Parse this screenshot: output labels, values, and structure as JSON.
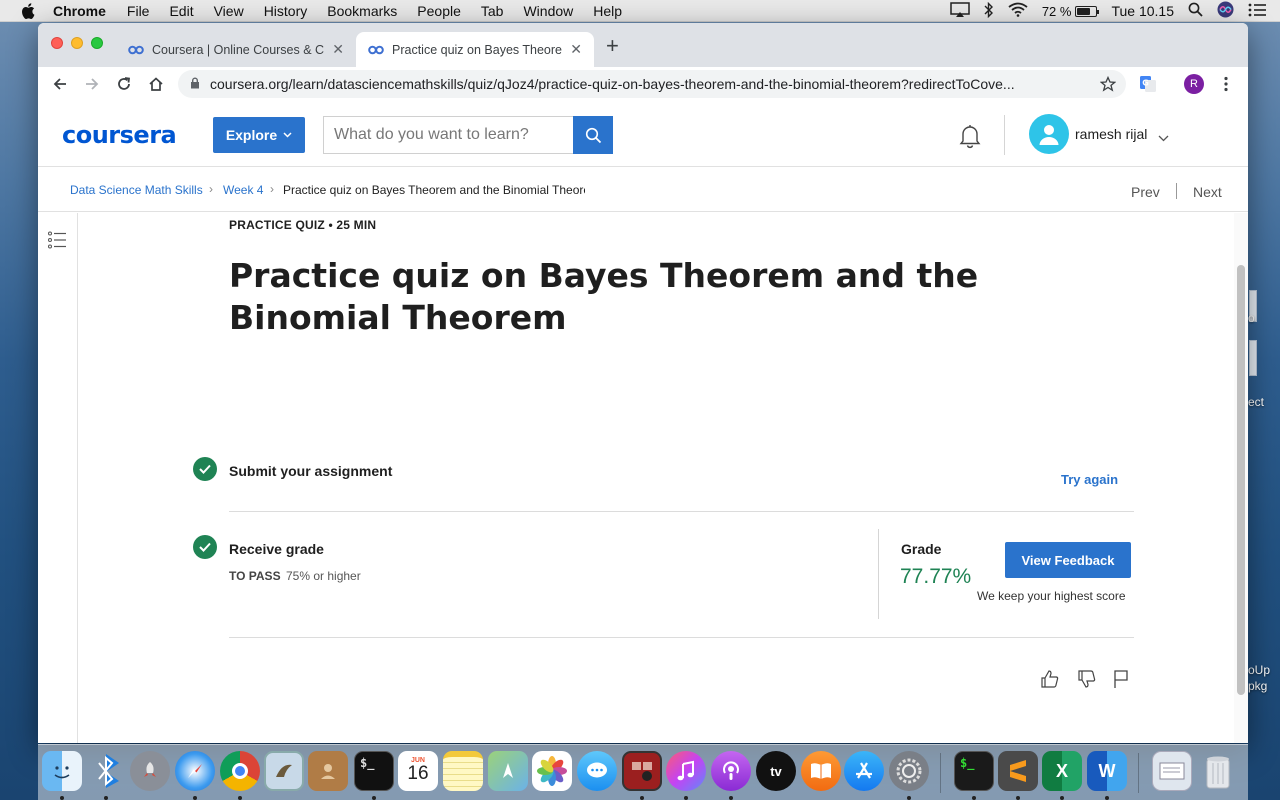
{
  "menubar": {
    "app": "Chrome",
    "items": [
      "File",
      "Edit",
      "View",
      "History",
      "Bookmarks",
      "People",
      "Tab",
      "Window",
      "Help"
    ],
    "battery_percent": "72 %",
    "battery_level": 0.72,
    "clock": "Tue 10.15"
  },
  "browser": {
    "tabs": [
      {
        "title": "Coursera | Online Courses & Credentials",
        "active": false
      },
      {
        "title": "Practice quiz on Bayes Theorem and the Binomial Theorem",
        "active": true
      }
    ],
    "url": "coursera.org/learn/datasciencemathskills/quiz/qJoz4/practice-quiz-on-bayes-theorem-and-the-binomial-theorem?redirectToCove...",
    "profile_initial": "R"
  },
  "header": {
    "logo": "coursera",
    "explore_label": "Explore",
    "search_placeholder": "What do you want to learn?",
    "username": "ramesh rijal"
  },
  "breadcrumb": {
    "items": [
      "Data Science Math Skills",
      "Week 4",
      "Practice quiz on Bayes Theorem and the Binomial Theorem"
    ],
    "prev": "Prev",
    "next": "Next"
  },
  "quiz": {
    "meta": "PRACTICE QUIZ • 25 MIN",
    "title": "Practice quiz on Bayes Theorem and the Binomial Theorem",
    "submit_title": "Submit your assignment",
    "try_again": "Try again",
    "receive_title": "Receive grade",
    "to_pass_label": "TO PASS",
    "to_pass_value": "75% or higher",
    "grade_label": "Grade",
    "grade_value": "77.77%",
    "view_feedback": "View Feedback",
    "highest_note": "We keep your highest score"
  },
  "desktop": {
    "edge_labels": [
      "o",
      "ect",
      "oUp",
      "pkg"
    ]
  },
  "dock": {
    "calendar_month": "JUN",
    "calendar_day": "16",
    "tv_label": "tv",
    "excel_letter": "X",
    "word_letter": "W",
    "terminal_prompt": "$_"
  },
  "colors": {
    "accent": "#2a73cc",
    "success": "#1f8354",
    "logo": "#0056d2"
  }
}
